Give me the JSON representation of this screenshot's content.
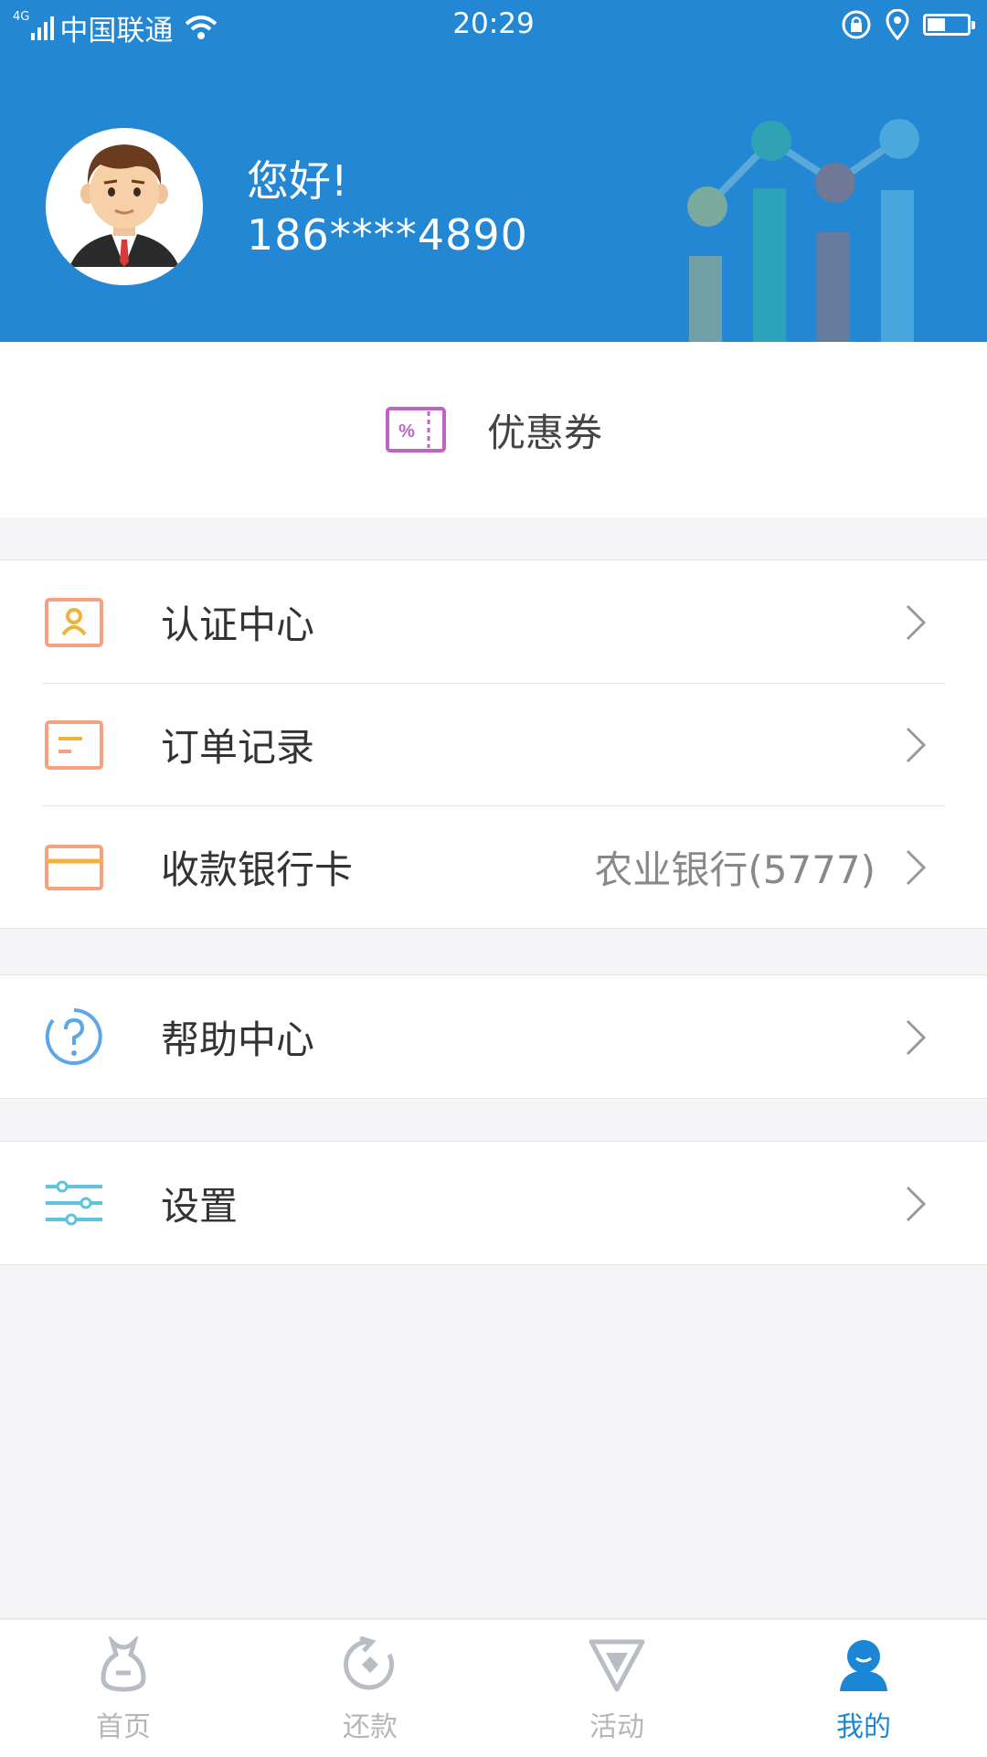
{
  "status_bar": {
    "network": "4G",
    "carrier": "中国联通",
    "time": "20:29",
    "battery_level": 0.45
  },
  "profile": {
    "greeting": "您好!",
    "phone": "186****4890"
  },
  "coupon": {
    "label": "优惠券",
    "icon": "coupon-icon"
  },
  "menu": {
    "group1": [
      {
        "label": "认证中心",
        "icon": "id-card-icon",
        "value": ""
      },
      {
        "label": "订单记录",
        "icon": "order-list-icon",
        "value": ""
      },
      {
        "label": "收款银行卡",
        "icon": "bank-card-icon",
        "value": "农业银行(5777)"
      }
    ],
    "group2": [
      {
        "label": "帮助中心",
        "icon": "help-icon",
        "value": ""
      }
    ],
    "group3": [
      {
        "label": "设置",
        "icon": "settings-sliders-icon",
        "value": ""
      }
    ]
  },
  "tabs": [
    {
      "label": "首页",
      "icon": "home-bag-icon",
      "active": false
    },
    {
      "label": "还款",
      "icon": "repay-icon",
      "active": false
    },
    {
      "label": "活动",
      "icon": "activity-icon",
      "active": false
    },
    {
      "label": "我的",
      "icon": "profile-icon",
      "active": true
    }
  ],
  "colors": {
    "header_bg": "#2387d3",
    "accent": "#1b86d6",
    "icon_orange": "#f5a07f",
    "coupon_purple": "#c064c4"
  }
}
